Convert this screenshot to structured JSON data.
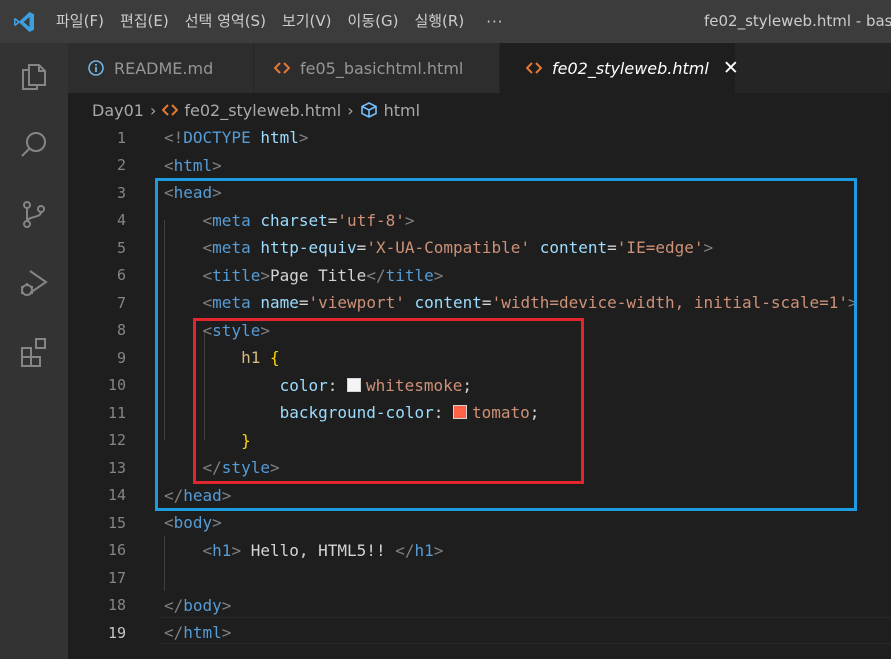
{
  "menu": {
    "items": [
      "파일(F)",
      "편집(E)",
      "선택 영역(S)",
      "보기(V)",
      "이동(G)",
      "실행(R)"
    ],
    "more": "···"
  },
  "window_title": "fe02_styleweb.html - bas",
  "activity_icons": [
    "explorer-icon",
    "search-icon",
    "source-control-icon",
    "run-debug-icon",
    "extensions-icon"
  ],
  "tabs": [
    {
      "label": "README.md",
      "icon": "info-icon"
    },
    {
      "label": "fe05_basichtml.html",
      "icon": "html-icon"
    },
    {
      "label": "fe02_styleweb.html",
      "icon": "html-icon",
      "close": "✕"
    }
  ],
  "breadcrumb": {
    "folder": "Day01",
    "file": "fe02_styleweb.html",
    "symbol": "html"
  },
  "lines": [
    {
      "n": "1",
      "segs": [
        [
          "t-br",
          "<!"
        ],
        [
          "t-tag",
          "DOCTYPE"
        ],
        [
          "t-text",
          " "
        ],
        [
          "t-attr",
          "html"
        ],
        [
          "t-br",
          ">"
        ]
      ]
    },
    {
      "n": "2",
      "segs": [
        [
          "t-br",
          "<"
        ],
        [
          "t-tag",
          "html"
        ],
        [
          "t-br",
          ">"
        ]
      ]
    },
    {
      "n": "3",
      "segs": [
        [
          "t-br",
          "<"
        ],
        [
          "t-tag",
          "head"
        ],
        [
          "t-br",
          ">"
        ]
      ]
    },
    {
      "n": "4",
      "segs": [
        [
          "t-text",
          "    "
        ],
        [
          "t-br",
          "<"
        ],
        [
          "t-tag",
          "meta"
        ],
        [
          "t-text",
          " "
        ],
        [
          "t-attr",
          "charset"
        ],
        [
          "t-text",
          "="
        ],
        [
          "t-str",
          "'utf-8'"
        ],
        [
          "t-br",
          ">"
        ]
      ]
    },
    {
      "n": "5",
      "segs": [
        [
          "t-text",
          "    "
        ],
        [
          "t-br",
          "<"
        ],
        [
          "t-tag",
          "meta"
        ],
        [
          "t-text",
          " "
        ],
        [
          "t-attr",
          "http-equiv"
        ],
        [
          "t-text",
          "="
        ],
        [
          "t-str",
          "'X-UA-Compatible'"
        ],
        [
          "t-text",
          " "
        ],
        [
          "t-attr",
          "content"
        ],
        [
          "t-text",
          "="
        ],
        [
          "t-str",
          "'IE=edge'"
        ],
        [
          "t-br",
          ">"
        ]
      ]
    },
    {
      "n": "6",
      "segs": [
        [
          "t-text",
          "    "
        ],
        [
          "t-br",
          "<"
        ],
        [
          "t-tag",
          "title"
        ],
        [
          "t-br",
          ">"
        ],
        [
          "t-text",
          "Page Title"
        ],
        [
          "t-br",
          "</"
        ],
        [
          "t-tag",
          "title"
        ],
        [
          "t-br",
          ">"
        ]
      ]
    },
    {
      "n": "7",
      "segs": [
        [
          "t-text",
          "    "
        ],
        [
          "t-br",
          "<"
        ],
        [
          "t-tag",
          "meta"
        ],
        [
          "t-text",
          " "
        ],
        [
          "t-attr",
          "name"
        ],
        [
          "t-text",
          "="
        ],
        [
          "t-str",
          "'viewport'"
        ],
        [
          "t-text",
          " "
        ],
        [
          "t-attr",
          "content"
        ],
        [
          "t-text",
          "="
        ],
        [
          "t-str",
          "'width=device-width, initial-scale=1'"
        ],
        [
          "t-br",
          ">"
        ]
      ]
    },
    {
      "n": "8",
      "segs": [
        [
          "t-text",
          "    "
        ],
        [
          "t-br",
          "<"
        ],
        [
          "t-tag",
          "style"
        ],
        [
          "t-br",
          ">"
        ]
      ]
    },
    {
      "n": "9",
      "segs": [
        [
          "t-text",
          "        "
        ],
        [
          "t-sel",
          "h1"
        ],
        [
          "t-text",
          " "
        ],
        [
          "t-brace",
          "{"
        ]
      ]
    },
    {
      "n": "10",
      "segs": [
        [
          "t-text",
          "            "
        ],
        [
          "t-prop",
          "color"
        ],
        [
          "t-text",
          ": "
        ],
        [
          "swatch",
          "#f5f5f5"
        ],
        [
          "t-val",
          "whitesmoke"
        ],
        [
          "t-text",
          ";"
        ]
      ]
    },
    {
      "n": "11",
      "segs": [
        [
          "t-text",
          "            "
        ],
        [
          "t-prop",
          "background-color"
        ],
        [
          "t-text",
          ": "
        ],
        [
          "swatch",
          "#ff6347"
        ],
        [
          "t-val",
          "tomato"
        ],
        [
          "t-text",
          ";"
        ]
      ]
    },
    {
      "n": "12",
      "segs": [
        [
          "t-text",
          "        "
        ],
        [
          "t-brace",
          "}"
        ]
      ]
    },
    {
      "n": "13",
      "segs": [
        [
          "t-text",
          "    "
        ],
        [
          "t-br",
          "</"
        ],
        [
          "t-tag",
          "style"
        ],
        [
          "t-br",
          ">"
        ]
      ]
    },
    {
      "n": "14",
      "segs": [
        [
          "t-br",
          "</"
        ],
        [
          "t-tag",
          "head"
        ],
        [
          "t-br",
          ">"
        ]
      ]
    },
    {
      "n": "15",
      "segs": [
        [
          "t-br",
          "<"
        ],
        [
          "t-tag",
          "body"
        ],
        [
          "t-br",
          ">"
        ]
      ]
    },
    {
      "n": "16",
      "segs": [
        [
          "t-text",
          "    "
        ],
        [
          "t-br",
          "<"
        ],
        [
          "t-tag",
          "h1"
        ],
        [
          "t-br",
          ">"
        ],
        [
          "t-text",
          " Hello, HTML5!! "
        ],
        [
          "t-br",
          "</"
        ],
        [
          "t-tag",
          "h1"
        ],
        [
          "t-br",
          ">"
        ]
      ]
    },
    {
      "n": "17",
      "segs": []
    },
    {
      "n": "18",
      "segs": [
        [
          "t-br",
          "</"
        ],
        [
          "t-tag",
          "body"
        ],
        [
          "t-br",
          ">"
        ]
      ]
    },
    {
      "n": "19",
      "segs": [
        [
          "t-br",
          "</"
        ],
        [
          "t-tag",
          "html"
        ],
        [
          "t-br",
          ">"
        ]
      ]
    }
  ],
  "current_line": "19",
  "colors": {
    "highlight_head": "#1e9ae0",
    "highlight_style": "#e3262e"
  }
}
